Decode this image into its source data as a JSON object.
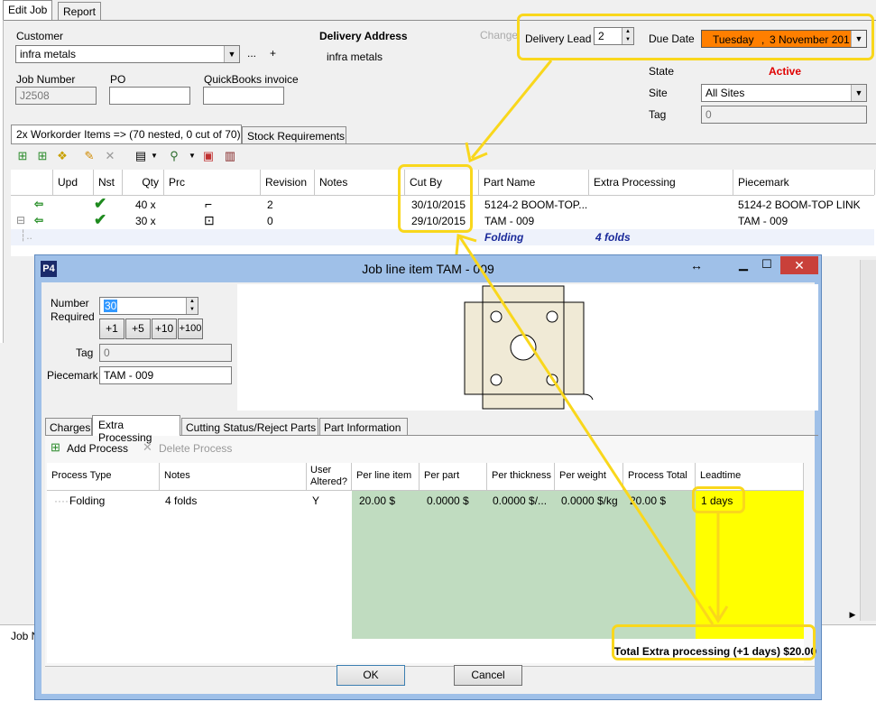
{
  "tabs": [
    {
      "label": "Edit Job"
    },
    {
      "label": "Report"
    }
  ],
  "customer": {
    "label": "Customer",
    "value": "infra metals",
    "more": "...",
    "add": "+"
  },
  "delivery": {
    "label": "Delivery Address",
    "value": "infra metals",
    "change": "Change"
  },
  "delivery_lead": {
    "label": "Delivery Lead",
    "value": "2"
  },
  "due_date": {
    "label": "Due Date",
    "day": "Tuesday",
    "sep": ",",
    "date": "3 November 201"
  },
  "job_number": {
    "label": "Job Number",
    "value": "J2508"
  },
  "po": {
    "label": "PO",
    "value": ""
  },
  "qb": {
    "label": "QuickBooks invoice",
    "value": ""
  },
  "state": {
    "label": "State",
    "value": "Active"
  },
  "site": {
    "label": "Site",
    "value": "All Sites"
  },
  "tag": {
    "label": "Tag",
    "value": "0"
  },
  "sub_tabs": [
    {
      "label": "2x Workorder Items => (70 nested, 0 cut of 70)"
    },
    {
      "label": "Stock Requirements"
    }
  ],
  "grid": {
    "headers": [
      "Upd",
      "Nst",
      "Qty",
      "Prc",
      "Revision",
      "Notes",
      "Cut By",
      "Part Name",
      "Extra Processing",
      "Piecemark"
    ],
    "rows": [
      {
        "qty": "40 x",
        "revision": "2",
        "cut_by": "30/10/2015",
        "part_name": "5124-2 BOOM-TOP...",
        "piecemark": "5124-2 BOOM-TOP LINK"
      },
      {
        "qty": "30 x",
        "revision": "0",
        "cut_by": "29/10/2015",
        "part_name": "TAM - 009",
        "piecemark": "TAM - 009"
      }
    ],
    "nested": {
      "process": "Folding",
      "notes": "4 folds"
    }
  },
  "job_notes_label": "Job N",
  "dialog": {
    "title": "Job line item TAM - 009",
    "resize_icon": "↔",
    "number_required": {
      "label1": "Number",
      "label2": "Required",
      "value": "30"
    },
    "increments": [
      "+1",
      "+5",
      "+10",
      "+100"
    ],
    "tag": {
      "label": "Tag",
      "value": "0"
    },
    "piecemark": {
      "label": "Piecemark",
      "value": "TAM - 009"
    },
    "tabs": [
      {
        "label": "Charges"
      },
      {
        "label": "Extra Processing"
      },
      {
        "label": "Cutting Status/Reject Parts"
      },
      {
        "label": "Part Information"
      }
    ],
    "add_process": "Add Process",
    "delete_process": "Delete Process",
    "headers": {
      "process_type": "Process Type",
      "notes": "Notes",
      "user_altered1": "User",
      "user_altered2": "Altered?",
      "per_line": "Per line item",
      "per_part": "Per part",
      "per_thickness": "Per thickness",
      "per_weight": "Per weight",
      "process_total": "Process Total",
      "leadtime": "Leadtime"
    },
    "row": {
      "process_type": "Folding",
      "notes": "4 folds",
      "user_altered": "Y",
      "per_line": "20.00 $",
      "per_part": "0.0000 $",
      "per_thickness": "0.0000 $/...",
      "per_weight": "0.0000 $/kg",
      "process_total": "20.00 $",
      "leadtime": "1 days"
    },
    "total": "Total Extra processing (+1 days) $20.00",
    "ok": "OK",
    "cancel": "Cancel"
  },
  "colors": {
    "accent_orange": "#ff7f00",
    "highlight": "#f9d71c",
    "state_red": "#e00000",
    "grid_green": "#c0dcc0",
    "yellow": "#ffff00",
    "close_red": "#c9403a",
    "nested_blue": "#1a2a9a"
  }
}
